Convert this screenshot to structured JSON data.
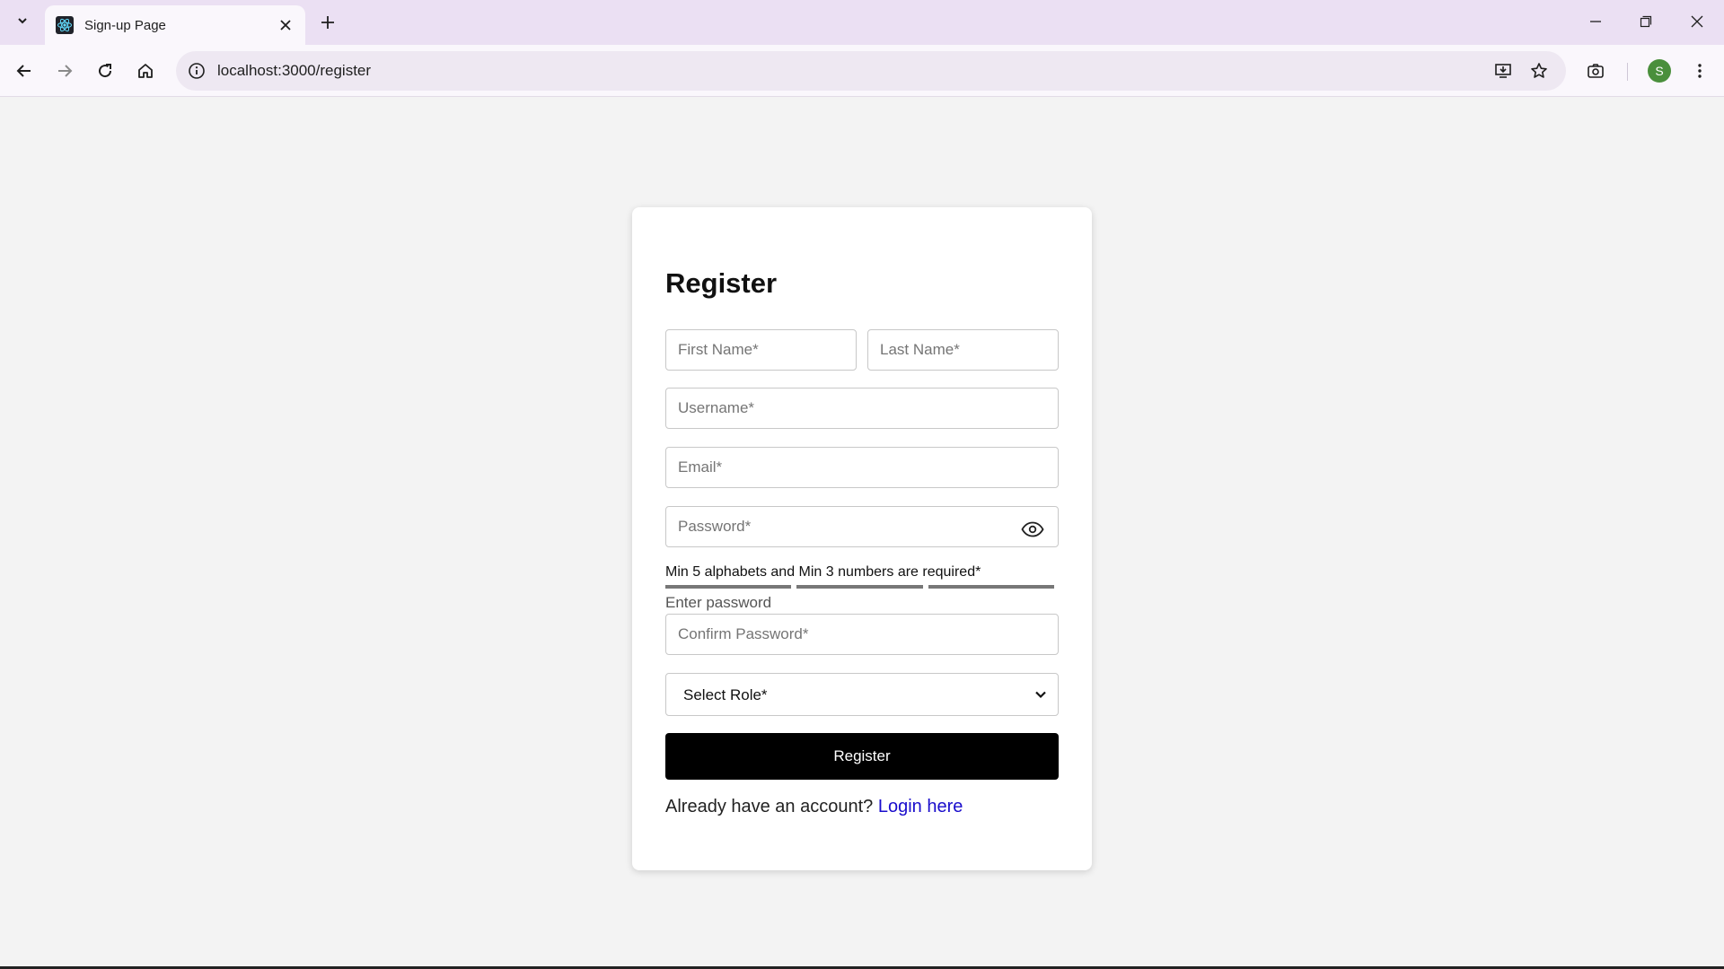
{
  "browser": {
    "tab_title": "Sign-up Page",
    "url": "localhost:3000/register",
    "avatar_initial": "S"
  },
  "form": {
    "title": "Register",
    "first_name_placeholder": "First Name*",
    "last_name_placeholder": "Last Name*",
    "username_placeholder": "Username*",
    "email_placeholder": "Email*",
    "password_placeholder": "Password*",
    "password_hint": "Min 5 alphabets and Min 3 numbers are required*",
    "strength_segments": 3,
    "password_label": "Enter password",
    "confirm_password_placeholder": "Confirm Password*",
    "role_select_value": "Select Role*",
    "submit_label": "Register",
    "footer_text": "Already have an account?",
    "login_link_text": "Login here"
  },
  "colors": {
    "page_background": "#f3f3f3",
    "submit_background": "#000000",
    "link": "#1a0dcc",
    "strength_bar": "#777777",
    "avatar": "#4a8f3c"
  }
}
